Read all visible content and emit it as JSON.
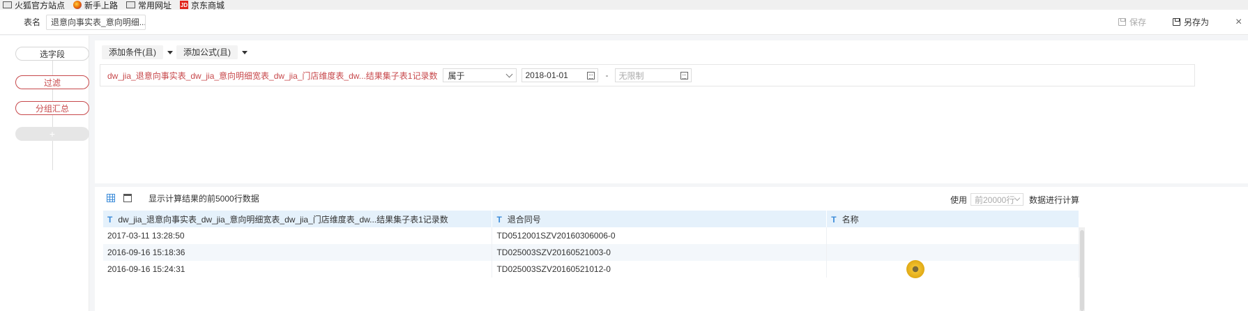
{
  "bookmarks": [
    {
      "icon": "folder-icon",
      "label": "火狐官方站点"
    },
    {
      "icon": "firefox-icon",
      "label": "新手上路"
    },
    {
      "icon": "folder-icon",
      "label": "常用网址"
    },
    {
      "icon": "jd-icon",
      "label": "京东商城",
      "icon_text": "JD"
    }
  ],
  "header": {
    "table_name_label": "表名",
    "table_name_value": "退意向事实表_意向明细...",
    "save_label": "保存",
    "save_as_label": "另存为",
    "close_glyph": "×"
  },
  "steps": {
    "select_fields": "选字段",
    "filter": "过滤",
    "group_summary": "分组汇总",
    "add": "+"
  },
  "toolbar": {
    "add_condition": "添加条件(且)",
    "add_formula": "添加公式(且)"
  },
  "condition": {
    "field": "dw_jia_退意向事实表_dw_jia_意向明细宽表_dw_jia_门店维度表_dw...结果集子表1记录数",
    "operator": "属于",
    "start_date": "2018-01-01",
    "separator": "-",
    "end_placeholder": "无限制"
  },
  "preview": {
    "note": "显示计算结果的前5000行数据",
    "use_label": "使用",
    "rows_select_placeholder": "前20000行",
    "compute_label": "数据进行计算",
    "type_marker": "T",
    "columns": [
      "dw_jia_退意向事实表_dw_jia_意向明细宽表_dw_jia_门店维度表_dw...结果集子表1记录数",
      "退合同号",
      "名称"
    ],
    "rows": [
      [
        "2017-03-11 13:28:50",
        "TD0512001SZV20160306006-0",
        ""
      ],
      [
        "2016-09-16 15:18:36",
        "TD025003SZV20160521003-0",
        ""
      ],
      [
        "2016-09-16 15:24:31",
        "TD025003SZV20160521012-0",
        ""
      ]
    ]
  },
  "colors": {
    "accent_red": "#c7484b",
    "header_blue": "#e5f1fb",
    "icon_blue": "#3b8bd9"
  }
}
